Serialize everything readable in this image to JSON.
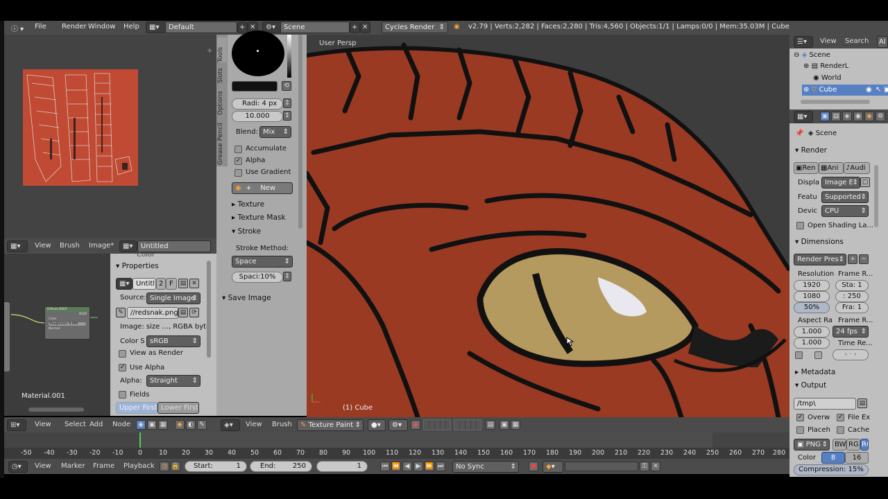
{
  "info_header": {
    "menus": [
      "File",
      "Render",
      "Window",
      "Help"
    ],
    "screen_layout": "Default",
    "scene_name": "Scene",
    "render_engine": "Cycles Render",
    "stats": "v2.79 | Verts:2,282 | Faces:2,280 | Tris:4,560 | Objects:1/1 | Lamps:0/0 | Mem:35.03M | Cube"
  },
  "tool_shelf": {
    "tabs": [
      "Tools",
      "Slots",
      "Options",
      "Grease Pencil"
    ],
    "radius": "Radi:  4 px",
    "strength": "10.000",
    "blend_label": "Blend:",
    "blend_value": "Mix",
    "accumulate": "Accumulate",
    "alpha": "Alpha",
    "use_gradient": "Use Gradient",
    "new_button": "New",
    "texture": "Texture",
    "texture_mask": "Texture Mask",
    "stroke": "Stroke",
    "stroke_method_label": "Stroke Method:",
    "stroke_method": "Space",
    "spacing": "Spaci:10%",
    "save_image": "Save Image"
  },
  "viewport": {
    "label": "User Persp",
    "object_label": "(1) Cube",
    "header": {
      "view": "View",
      "brush": "Brush",
      "mode": "Texture Paint"
    }
  },
  "image_editor": {
    "header": {
      "view": "View",
      "brush": "Brush",
      "image": "Image*",
      "image_name": "Untitled"
    },
    "color_label": "Color",
    "properties": "Properties",
    "image_field": "Untitl",
    "users": "2",
    "fake": "F",
    "source_label": "Source:",
    "source": "Single Image",
    "filepath": "//redsnak.png",
    "image_info": "Image: size ..., RGBA byte",
    "color_space_label": "Color S",
    "color_space": "sRGB",
    "view_as_render": "View as Render",
    "use_alpha": "Use Alpha",
    "alpha_label": "Alpha:",
    "alpha_mode": "Straight",
    "fields": "Fields",
    "upper_first": "Upper First",
    "lower_first": "Lower First"
  },
  "node_editor": {
    "material": "Material.001",
    "node_title": "Diffuse BSDF",
    "node_output": "BSDF",
    "node_rows": [
      "Color",
      "Roughness: 0.000",
      "Normal"
    ],
    "header": {
      "view": "View",
      "select": "Select",
      "add": "Add",
      "node": "Node"
    }
  },
  "outliner": {
    "header": {
      "view": "View",
      "search": "Search",
      "all": "Al"
    },
    "items": [
      "Scene",
      "RenderL",
      "World",
      "Cube"
    ]
  },
  "properties": {
    "context": "Scene",
    "render_section": "Render",
    "render_buttons": [
      "Ren",
      "Ani",
      "Audi"
    ],
    "display_label": "Displa",
    "display": "Image E",
    "feature_label": "Featu",
    "feature": "Supported",
    "device_label": "Devic",
    "device": "CPU",
    "osl": "Open Shading La...",
    "dimensions": "Dimensions",
    "render_presets": "Render Pres",
    "resolution_label": "Resolution",
    "res_x": "1920",
    "res_y": "1080",
    "res_pct": "50%",
    "frame_range_label": "Frame R...",
    "frame_start": "Sta: 1",
    "frame_end": ": 250",
    "frame_step": "Fra: 1",
    "aspect_label": "Aspect Ra",
    "aspect_x": "1.000",
    "aspect_y": "1.000",
    "frame_rate_label": "Frame R...",
    "fps": "24 fps",
    "time_remap": "Time Re...",
    "metadata": "Metadata",
    "output": "Output",
    "output_path": "/tmp\\",
    "overwrite": "Overw",
    "file_ext": "File Ex",
    "placeholders": "Placeh",
    "cache": "Cache",
    "format": "PNG",
    "color_modes": [
      "BW",
      "RG",
      "RG"
    ],
    "color_label": "Color",
    "color_depths": [
      "8",
      "16"
    ],
    "compression": "Compression: 15%"
  },
  "timeline": {
    "ticks": [
      "-50",
      "-40",
      "-30",
      "-20",
      "-10",
      "0",
      "10",
      "20",
      "30",
      "40",
      "50",
      "60",
      "70",
      "80",
      "90",
      "100",
      "110",
      "120",
      "130",
      "140",
      "150",
      "160",
      "170",
      "180",
      "190",
      "200",
      "210",
      "220",
      "230",
      "240",
      "250",
      "260",
      "270",
      "280"
    ],
    "header": {
      "view": "View",
      "marker": "Marker",
      "frame": "Frame",
      "playback": "Playback"
    },
    "start": "Start:",
    "start_value": "1",
    "end": "End:",
    "end_value": "250",
    "current": "1",
    "sync": "No Sync"
  },
  "colors": {
    "snake_red": "#9a3a22",
    "eye_gold": "#b49a5e",
    "panel_bg": "#bfbfbf",
    "header_bg": "#4b4b4b",
    "viewport_bg": "#3d3d3d",
    "accent_blue": "#5680c2"
  }
}
